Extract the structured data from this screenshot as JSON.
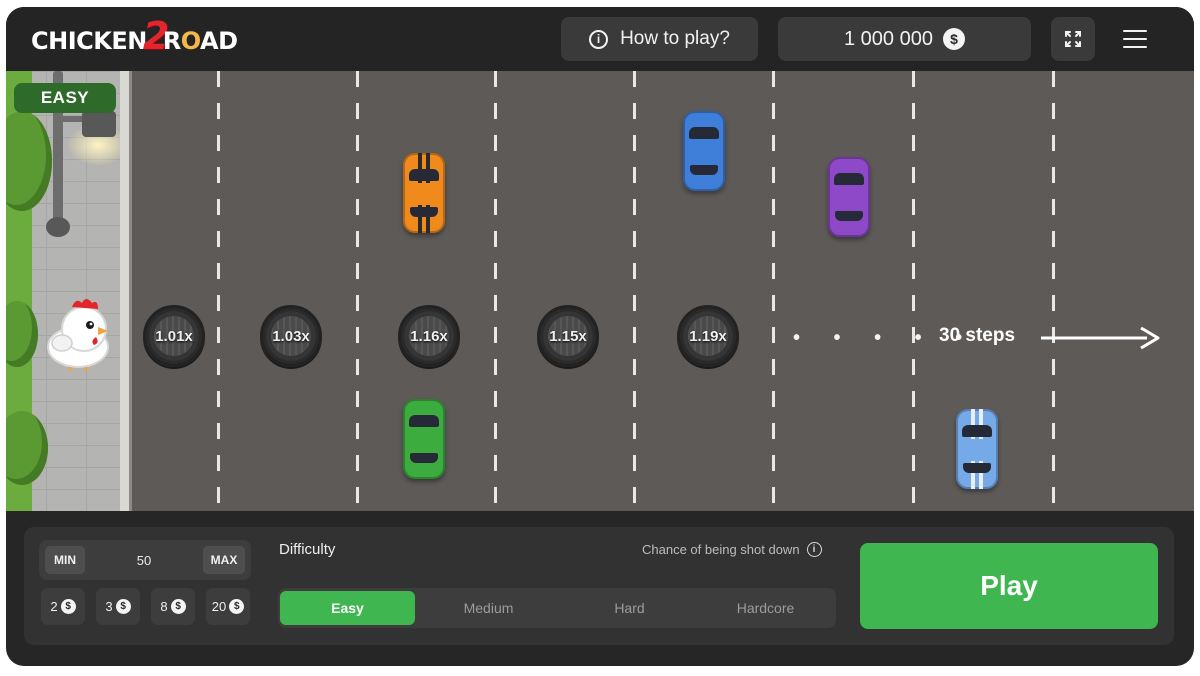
{
  "header": {
    "logo_prefix": "CHICKEN",
    "logo_number": "2",
    "logo_suffix_1": "R",
    "logo_suffix_2": "O",
    "logo_suffix_3": "AD",
    "how_to_play_label": "How to play?",
    "balance": "1 000 000",
    "currency_symbol": "$"
  },
  "game": {
    "difficulty_badge": "EASY",
    "multipliers": [
      "1.01x",
      "1.03x",
      "1.16x",
      "1.15x",
      "1.19x"
    ],
    "more_dots": "• • • • •",
    "steps_label": "30 steps",
    "car_colors": [
      "#f08a1c",
      "#3f7fd9",
      "#8e49c8",
      "#3cac3f",
      "#76a9e8"
    ]
  },
  "controls": {
    "min_label": "MIN",
    "max_label": "MAX",
    "bet_amount": "50",
    "quick_bets": [
      "2",
      "3",
      "8",
      "20"
    ],
    "difficulty_title": "Difficulty",
    "chance_label": "Chance of being shot down",
    "difficulty_options": [
      "Easy",
      "Medium",
      "Hard",
      "Hardcore"
    ],
    "selected_difficulty": "Easy",
    "play_label": "Play"
  },
  "colors": {
    "accent_green": "#3fb650",
    "background": "#262626",
    "road": "#5d5a58"
  }
}
